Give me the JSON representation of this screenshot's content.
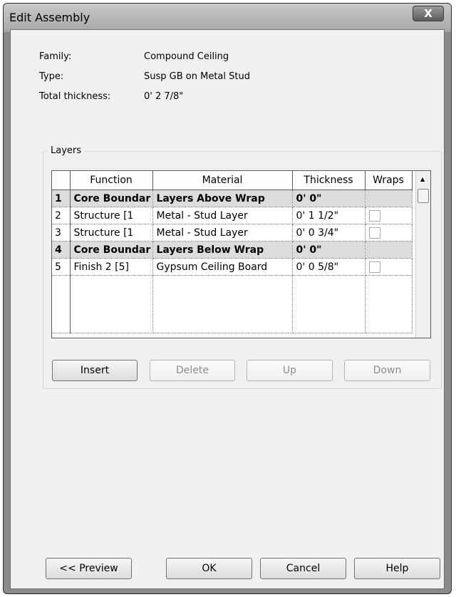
{
  "window": {
    "title": "Edit Assembly",
    "close_glyph": "X"
  },
  "info": {
    "family_label": "Family:",
    "family_value": "Compound Ceiling",
    "type_label": "Type:",
    "type_value": "Susp GB on Metal Stud",
    "thickness_label": "Total thickness:",
    "thickness_value": "0'  2 7/8\""
  },
  "layers": {
    "group_label": "Layers",
    "headers": {
      "function": "Function",
      "material": "Material",
      "thickness": "Thickness",
      "wraps": "Wraps"
    },
    "rows": [
      {
        "num": "1",
        "function": "Core Boundar",
        "material": "Layers Above Wrap",
        "thickness": "0'  0\"",
        "core": true
      },
      {
        "num": "2",
        "function": "Structure [1",
        "material": "Metal - Stud Layer",
        "thickness": "0'  1 1/2\"",
        "core": false
      },
      {
        "num": "3",
        "function": "Structure [1",
        "material": "Metal - Stud Layer",
        "thickness": "0'  0 3/4\"",
        "core": false
      },
      {
        "num": "4",
        "function": "Core Boundar",
        "material": "Layers Below Wrap",
        "thickness": "0'  0\"",
        "core": true
      },
      {
        "num": "5",
        "function": "Finish 2 [5]",
        "material": "Gypsum Ceiling Board",
        "thickness": "0'  0 5/8\"",
        "core": false
      }
    ]
  },
  "layer_buttons": {
    "insert": "Insert",
    "delete": "Delete",
    "up": "Up",
    "down": "Down"
  },
  "footer_buttons": {
    "preview": "<< Preview",
    "ok": "OK",
    "cancel": "Cancel",
    "help": "Help"
  }
}
